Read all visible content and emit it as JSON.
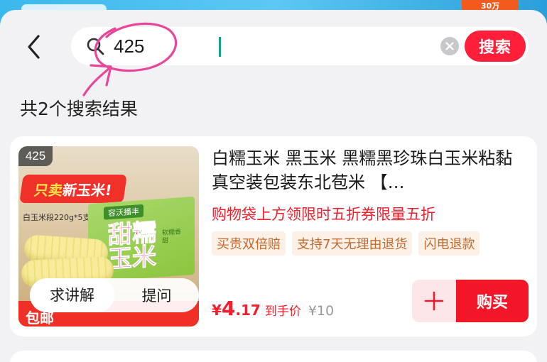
{
  "background_strip": {
    "badge_text": "30万"
  },
  "search": {
    "value": "425",
    "button_label": "搜索"
  },
  "results": {
    "count_text": "共2个搜索结果"
  },
  "product": {
    "image_badge": "425",
    "image_banner_prefix": "只卖",
    "image_banner_rest": " 新玉米!",
    "image_spec": "白玉米段220g*5支",
    "image_box_brand": "容沃播丰",
    "image_box_big": "甜糯玉米",
    "image_box_small": "软糯香甜",
    "image_bottom_text": "包邮",
    "ask_label": "求讲解",
    "question_label": "提问",
    "title": "白糯玉米 黑玉米 黑糯黑珍珠白玉米粘黏真空装包装东北苞米 【…",
    "promo": "购物袋上方领限时五折券限量五折",
    "tags": [
      "买贵双倍赔",
      "支持7天无理由退货",
      "闪电退款"
    ],
    "price_symbol": "¥",
    "price_int": "4",
    "price_dec": ".17",
    "price_label": "到手价",
    "original_price": "¥10",
    "add_label": "+",
    "buy_label": "购买"
  },
  "colors": {
    "accent_red": "#f31628",
    "annotation_pink": "#e8469a",
    "tag_bg": "#fdf1e7",
    "tag_text": "#c26a2d"
  },
  "icons": {
    "back": "chevron-left-icon",
    "search": "search-icon",
    "clear": "clear-icon",
    "add": "plus-icon"
  }
}
